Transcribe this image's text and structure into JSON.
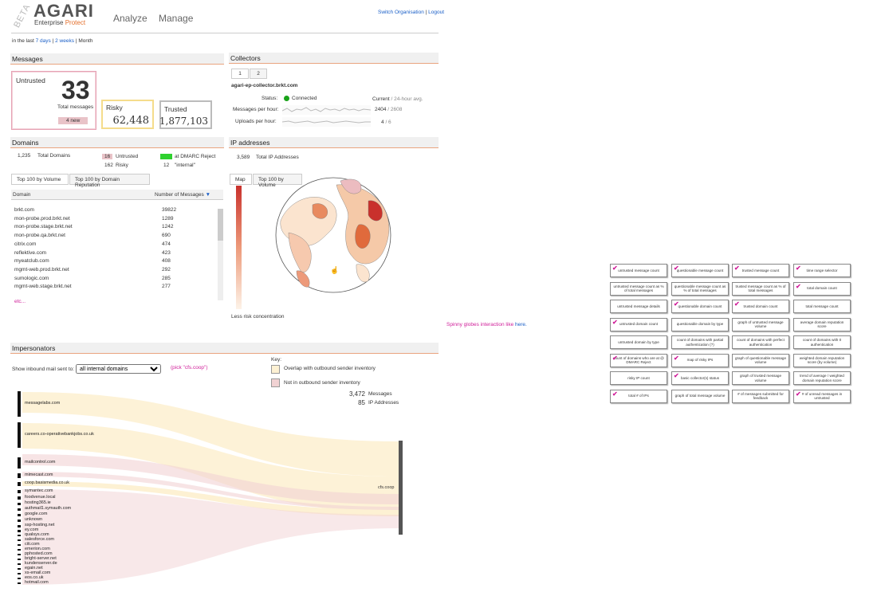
{
  "header": {
    "beta": "BETA",
    "logo": "AGARI",
    "product_prefix": "Enterprise",
    "product_suffix": "Protect",
    "nav": [
      "Analyze",
      "Manage"
    ],
    "switch_org": "Switch Organisation",
    "separator": "|",
    "logout": "Logout"
  },
  "time_range": {
    "prefix": "in the last",
    "options": [
      "7 days",
      "2 weeks",
      "Month"
    ],
    "separator": "|"
  },
  "messages": {
    "title": "Messages",
    "untrusted_label": "Untrusted",
    "untrusted_count": "33",
    "total_messages_label": "Total messages",
    "new_badge": "4 new",
    "risky_label": "Risky",
    "risky_count": "62,448",
    "trusted_label": "Trusted",
    "trusted_count": "1,877,103"
  },
  "collectors": {
    "title": "Collectors",
    "tabs": [
      "1",
      "2"
    ],
    "host": "agari-ep-collector.brkt.com",
    "status_label": "Status:",
    "status_value": "Connected",
    "current_label": "Current",
    "avg_label": "/ 24-hour avg.",
    "mph_label": "Messages per hour:",
    "mph_current": "2404",
    "mph_avg": "/ 2608",
    "uph_label": "Uploads per hour:",
    "uph_current": "4",
    "uph_avg": "/ 6",
    "status_color": "#1aa31a"
  },
  "domains": {
    "title": "Domains",
    "total_count": "1,235",
    "total_label": "Total Domains",
    "untrusted_count": "16",
    "untrusted_label": "Untrusted",
    "risky_count": "162",
    "risky_label": "Risky",
    "dmarc_count": "46",
    "dmarc_label": "at DMARC Reject",
    "internal_count": "12",
    "internal_label": "\"internal\"",
    "tabs": [
      "Top 100 by Volume",
      "Top 100 by Domain Reputation"
    ],
    "col_domain": "Domain",
    "col_count": "Number of Messages",
    "rows": [
      {
        "d": "brkt.com",
        "n": "39822"
      },
      {
        "d": "mon-probe.prod.brkt.net",
        "n": "1289"
      },
      {
        "d": "mon-probe.stage.brkt.net",
        "n": "1242"
      },
      {
        "d": "mon-probe.qa.brkt.net",
        "n": "690"
      },
      {
        "d": "citrix.com",
        "n": "474"
      },
      {
        "d": "reflektive.com",
        "n": "423"
      },
      {
        "d": "myeatclub.com",
        "n": "408"
      },
      {
        "d": "mgmt-web.prod.brkt.net",
        "n": "292"
      },
      {
        "d": "sumologic.com",
        "n": "285"
      },
      {
        "d": "mgmt-web.stage.brkt.net",
        "n": "277"
      }
    ],
    "etc": "etc..."
  },
  "ip": {
    "title": "IP addresses",
    "total_count": "3,589",
    "total_label": "Total IP Addresses",
    "tabs": [
      "Map",
      "Top 100 by Volume"
    ],
    "legend_label": "Less risk concentration"
  },
  "impersonators": {
    "title": "Impersonators",
    "show_label": "Show inbound mail sent to:",
    "select_value": "all internal domains",
    "hint": "(pick \"cfs.coop\")",
    "key_label": "Key:",
    "key_overlap": "Overlap with outbound sender inventory",
    "key_not_in": "Not in outbound sender inventory",
    "messages_count": "3,472",
    "messages_label": "Messages",
    "ip_count": "85",
    "ip_label": "IP Addresses",
    "target": "cfs.coop",
    "sources": [
      "messagelabs.com",
      "careers.co-operativebankjobs.co.uk",
      "mailcontrol.com",
      "mimecast.com",
      "coop.basismedia.co.uk",
      "symantec.com",
      "foodvenue.local",
      "hosting365.ie",
      "authmail1.symauth.com",
      "google.com",
      "unknown",
      "ssp-hosting.net",
      "ey.com",
      "qualsys.com",
      "salesforce.com",
      "citi.com",
      "emerion.com",
      "pphosted.com",
      "bright-server.net",
      "kundenserver.de",
      "egain.net",
      "xs-email.com",
      "eos.co.uk",
      "hotmail.com"
    ],
    "overlap_color": "#fdf1d3",
    "not_in_color": "#f1d2d3"
  },
  "annotation": {
    "text": "Spinny globes interaction like",
    "link": "here."
  },
  "notes": [
    {
      "t": "untrusted message count",
      "c": true
    },
    {
      "t": "questionable message count",
      "c": true
    },
    {
      "t": "trusted message count",
      "c": true
    },
    {
      "t": "time range selector",
      "c": true
    },
    {
      "t": "untrusted message count as % of total messages",
      "c": false
    },
    {
      "t": "questionable message count as % of total messages",
      "c": false
    },
    {
      "t": "trusted message count as % of total messages",
      "c": false
    },
    {
      "t": "total domain count",
      "c": true
    },
    {
      "t": "untrusted message details",
      "c": false
    },
    {
      "t": "questionable domain count",
      "c": true
    },
    {
      "t": "trusted domain count",
      "c": true
    },
    {
      "t": "total message count",
      "c": false
    },
    {
      "t": "untrusted domain count",
      "c": true
    },
    {
      "t": "questionable domain by type",
      "c": false
    },
    {
      "t": "graph of untrusted message volume",
      "c": false
    },
    {
      "t": "average domain reputation score",
      "c": false
    },
    {
      "t": "untrusted domain by type",
      "c": false
    },
    {
      "t": "count of domains with partial authentication (?)",
      "c": false
    },
    {
      "t": "count of domains with perfect authentication",
      "c": false
    },
    {
      "t": "count of domains with 0 authentication",
      "c": false
    },
    {
      "t": "count of domains who are at @ DMARC Reject",
      "c": true
    },
    {
      "t": "map of risky IPs",
      "c": true
    },
    {
      "t": "graph of questionable message volume",
      "c": false
    },
    {
      "t": "weighted domain reputation score (by volume)",
      "c": false
    },
    {
      "t": "risky IP count",
      "c": false
    },
    {
      "t": "basic collector(s) status",
      "c": true
    },
    {
      "t": "graph of trusted message volume",
      "c": false
    },
    {
      "t": "trend of average / weighted domain reputation score",
      "c": false
    },
    {
      "t": "total # of IPs",
      "c": true
    },
    {
      "t": "graph of total message volume",
      "c": false
    },
    {
      "t": "# of messages submitted for feedback",
      "c": false
    },
    {
      "t": "# of unread messages in untrusted",
      "c": true
    }
  ]
}
